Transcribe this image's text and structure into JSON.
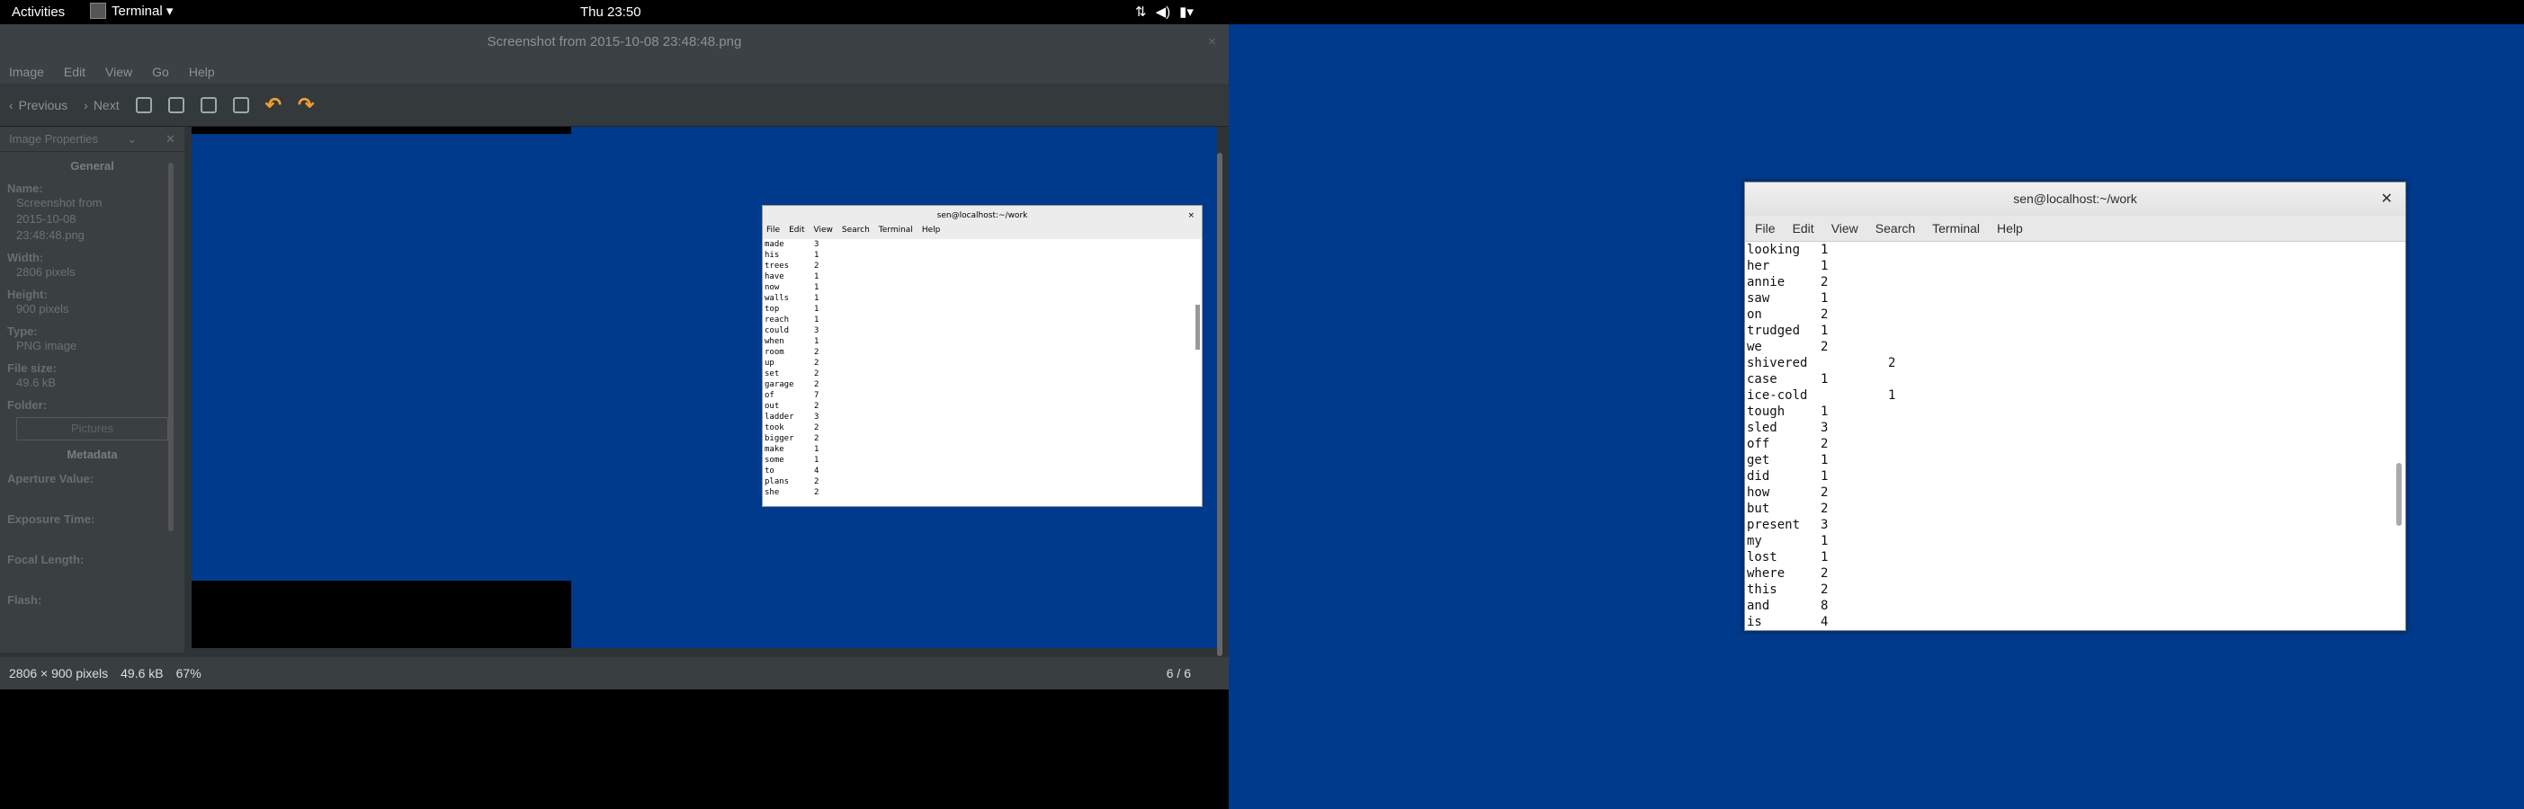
{
  "topbar": {
    "activities": "Activities",
    "app": "Terminal ▾",
    "clock": "Thu 23:50",
    "tray_icons": [
      "network-icon",
      "volume-icon",
      "battery-icon"
    ]
  },
  "eog": {
    "title": "Screenshot from 2015-10-08 23:48:48.png",
    "menu": [
      "Image",
      "Edit",
      "View",
      "Go",
      "Help"
    ],
    "prev_label": "Previous",
    "next_label": "Next",
    "sidebar": {
      "header": "Image Properties",
      "section_general": "General",
      "name_label": "Name:",
      "name_value": [
        "Screenshot from",
        "2015-10-08",
        "23:48:48.png"
      ],
      "width_label": "Width:",
      "width_value": "2806 pixels",
      "height_label": "Height:",
      "height_value": "900 pixels",
      "type_label": "Type:",
      "type_value": "PNG image",
      "filesize_label": "File size:",
      "filesize_value": "49.6 kB",
      "folder_label": "Folder:",
      "folder_button": "Pictures",
      "section_metadata": "Metadata",
      "aperture_label": "Aperture Value:",
      "exposure_label": "Exposure Time:",
      "focal_label": "Focal Length:",
      "flash_label": "Flash:"
    },
    "status": {
      "dims": "2806 × 900 pixels",
      "size": "49.6 kB",
      "zoom": "67%",
      "pager": "6 / 6"
    },
    "inner_terminal": {
      "title": "sen@localhost:~/work",
      "menu": [
        "File",
        "Edit",
        "View",
        "Search",
        "Terminal",
        "Help"
      ],
      "rows": [
        [
          "made",
          "3"
        ],
        [
          "his",
          "1"
        ],
        [
          "trees",
          "2"
        ],
        [
          "have",
          "1"
        ],
        [
          "now",
          "1"
        ],
        [
          "walls",
          "1"
        ],
        [
          "top",
          "1"
        ],
        [
          "reach",
          "1"
        ],
        [
          "could",
          "3"
        ],
        [
          "when",
          "1"
        ],
        [
          "room",
          "2"
        ],
        [
          "up",
          "2"
        ],
        [
          "set",
          "2"
        ],
        [
          "garage",
          "2"
        ],
        [
          "of",
          "7"
        ],
        [
          "out",
          "2"
        ],
        [
          "ladder",
          "3"
        ],
        [
          "took",
          "2"
        ],
        [
          "bigger",
          "2"
        ],
        [
          "make",
          "1"
        ],
        [
          "some",
          "1"
        ],
        [
          "to",
          "4"
        ],
        [
          "plans",
          "2"
        ],
        [
          "she",
          "2"
        ]
      ]
    }
  },
  "terminal": {
    "title": "sen@localhost:~/work",
    "menu": [
      "File",
      "Edit",
      "View",
      "Search",
      "Terminal",
      "Help"
    ],
    "rows": [
      [
        "looking",
        "1"
      ],
      [
        "her",
        "1"
      ],
      [
        "annie",
        "2"
      ],
      [
        "saw",
        "1"
      ],
      [
        "on",
        "2"
      ],
      [
        "trudged",
        "1"
      ],
      [
        "we",
        "2"
      ],
      [
        "shivered",
        "2"
      ],
      [
        "case",
        "1"
      ],
      [
        "ice-cold",
        "1"
      ],
      [
        "tough",
        "1"
      ],
      [
        "sled",
        "3"
      ],
      [
        "off",
        "2"
      ],
      [
        "get",
        "1"
      ],
      [
        "did",
        "1"
      ],
      [
        "how",
        "2"
      ],
      [
        "but",
        "2"
      ],
      [
        "present",
        "3"
      ],
      [
        "my",
        "1"
      ],
      [
        "lost",
        "1"
      ],
      [
        "where",
        "2"
      ],
      [
        "this",
        "2"
      ],
      [
        "and",
        "8"
      ],
      [
        "is",
        "4"
      ]
    ]
  }
}
